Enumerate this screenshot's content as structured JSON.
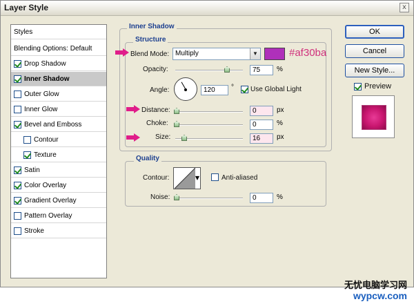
{
  "window": {
    "title": "Layer Style",
    "close_glyph": "x"
  },
  "styles_list": {
    "header": "Styles",
    "blending": "Blending Options: Default",
    "items": [
      {
        "label": "Drop Shadow",
        "checked": true
      },
      {
        "label": "Inner Shadow",
        "checked": true,
        "selected": true
      },
      {
        "label": "Outer Glow",
        "checked": false
      },
      {
        "label": "Inner Glow",
        "checked": false
      },
      {
        "label": "Bevel and Emboss",
        "checked": true
      },
      {
        "label": "Contour",
        "checked": false,
        "indent": true
      },
      {
        "label": "Texture",
        "checked": true,
        "indent": true
      },
      {
        "label": "Satin",
        "checked": true
      },
      {
        "label": "Color Overlay",
        "checked": true
      },
      {
        "label": "Gradient Overlay",
        "checked": true
      },
      {
        "label": "Pattern Overlay",
        "checked": false
      },
      {
        "label": "Stroke",
        "checked": false
      }
    ]
  },
  "inner_shadow": {
    "section_title": "Inner Shadow",
    "structure": {
      "title": "Structure",
      "blend_mode_label": "Blend Mode:",
      "blend_mode_value": "Multiply",
      "color_hex": "#af30ba",
      "swatch_color": "#af30ba",
      "opacity_label": "Opacity:",
      "opacity_value": "75",
      "opacity_unit": "%",
      "angle_label": "Angle:",
      "angle_value": "120",
      "angle_unit": "°",
      "global_light_label": "Use Global Light",
      "global_light_checked": true,
      "distance_label": "Distance:",
      "distance_value": "0",
      "distance_unit": "px",
      "choke_label": "Choke:",
      "choke_value": "0",
      "choke_unit": "%",
      "size_label": "Size:",
      "size_value": "16",
      "size_unit": "px"
    },
    "quality": {
      "title": "Quality",
      "contour_label": "Contour:",
      "anti_aliased_label": "Anti-aliased",
      "anti_aliased_checked": false,
      "noise_label": "Noise:",
      "noise_value": "0",
      "noise_unit": "%"
    }
  },
  "buttons": {
    "ok": "OK",
    "cancel": "Cancel",
    "new_style": "New Style...",
    "preview_label": "Preview",
    "preview_checked": true
  },
  "watermark": {
    "line1": "无忧电脑学习网",
    "line2": "wypcw.com"
  },
  "colors": {
    "accent_pink": "#e01d8a",
    "hex_text": "#d0307c",
    "section_title": "#1c3f8f"
  }
}
